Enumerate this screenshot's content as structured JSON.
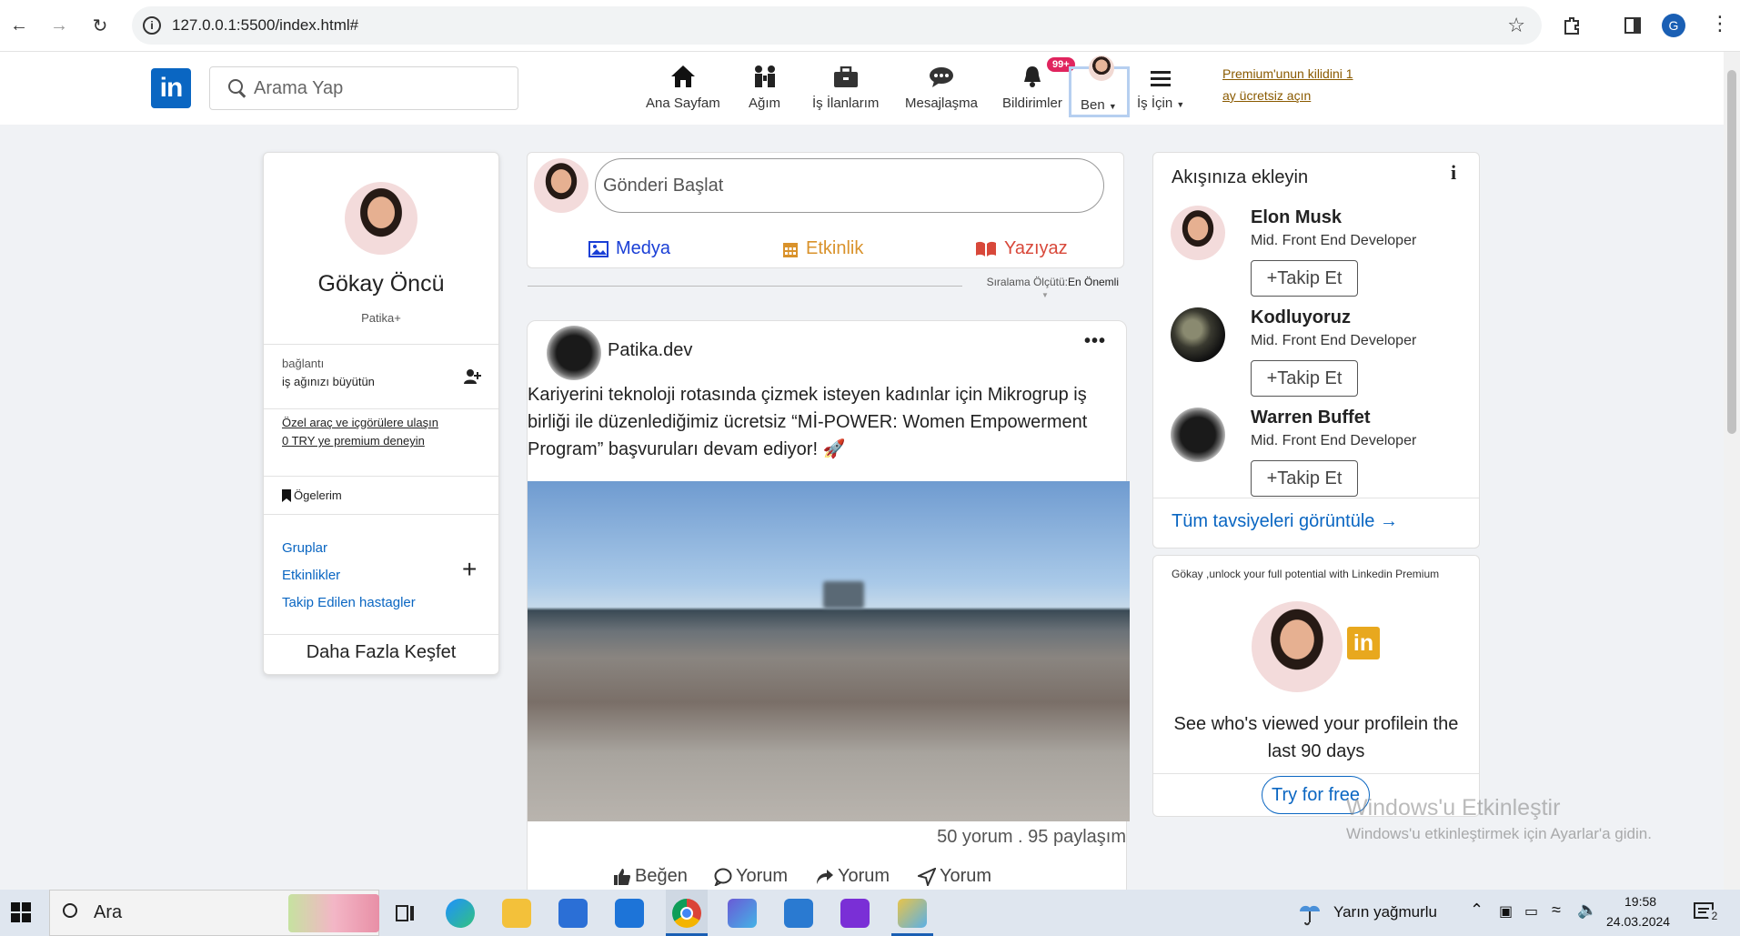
{
  "browser": {
    "url": "127.0.0.1:5500/index.html#",
    "profile_initial": "G"
  },
  "nav": {
    "search_placeholder": "Arama Yap",
    "items": [
      {
        "label": "Ana Sayfam",
        "icon": "home-icon"
      },
      {
        "label": "Ağım",
        "icon": "network-icon"
      },
      {
        "label": "İş İlanlarım",
        "icon": "briefcase-icon"
      },
      {
        "label": "Mesajlaşma",
        "icon": "chat-icon"
      },
      {
        "label": "Bildirimler",
        "icon": "bell-icon"
      },
      {
        "label": "Ben",
        "icon": "avatar"
      },
      {
        "label": "İş İçin",
        "icon": "menu-icon"
      }
    ],
    "notification_badge": "99+",
    "premium_line1": "Premium'unun kilidini 1",
    "premium_line2": "ay ücretsiz açın"
  },
  "profile_card": {
    "name": "Gökay Öncü",
    "subtitle": "Patika+",
    "connections_label": "bağlantı",
    "grow_network": "iş ağınızı büyütün",
    "premium_line1": "Özel araç ve içgörülere ulaşın",
    "premium_line2": "0 TRY ye premium deneyin",
    "items_label": "Ögelerim",
    "groups": "Gruplar",
    "events": "Etkinlikler",
    "hashtags": "Takip Edilen hastagler",
    "discover_more": "Daha Fazla Keşfet"
  },
  "composer": {
    "placeholder": "Gönderi Başlat",
    "media": "Medya",
    "event": "Etkinlik",
    "article": "Yazıyaz",
    "colors": {
      "media": "#1a3fd6",
      "event": "#d9922b",
      "article": "#d8483a"
    }
  },
  "sort": {
    "label": "Sıralama Ölçütü:",
    "value": "En Önemli"
  },
  "post": {
    "author": "Patika.dev",
    "text": "Kariyerini teknoloji rotasında çizmek isteyen kadınlar için Mikrogrup iş birliği ile düzenlediğimiz ücretsiz “Mİ-POWER: Women Empowerment Program” başvuruları devam ediyor! 🚀",
    "stats": "50 yorum . 95 paylaşım",
    "actions": [
      "Beğen",
      "Yorum",
      "Yorum",
      "Yorum"
    ]
  },
  "follow": {
    "title": "Akışınıza ekleyin",
    "people": [
      {
        "name": "Elon Musk",
        "role": "Mid. Front End Developer",
        "button": "Takip Et"
      },
      {
        "name": "Kodluyoruz",
        "role": "Mid. Front End Developer",
        "button": "Takip Et"
      },
      {
        "name": "Warren Buffet",
        "role": "Mid. Front End Developer",
        "button": "Takip Et"
      }
    ],
    "view_all": "Tüm tavsiyeleri görüntüle"
  },
  "premium": {
    "top": "Gökay ,unlock your full potential with Linkedin Premium",
    "desc_line1": "See who's viewed your profilein the",
    "desc_line2": "last 90 days",
    "button": "Try for free"
  },
  "watermark": {
    "title": "Windows'u Etkinleştir",
    "subtitle": "Windows'u etkinleştirmek için Ayarlar'a gidin."
  },
  "taskbar": {
    "search": "Ara",
    "weather": "Yarın yağmurlu",
    "time": "19:58",
    "date": "24.03.2024",
    "notifications": "2"
  }
}
